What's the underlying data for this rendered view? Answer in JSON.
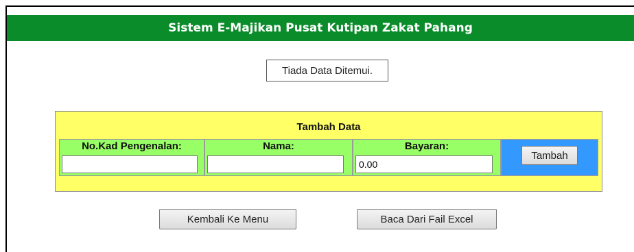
{
  "header": {
    "title": "Sistem E-Majikan Pusat Kutipan Zakat Pahang"
  },
  "notice": {
    "text": "Tiada Data Ditemui."
  },
  "form": {
    "title": "Tambah Data",
    "ic": {
      "label": "No.Kad Pengenalan:",
      "value": ""
    },
    "nama": {
      "label": "Nama:",
      "value": ""
    },
    "bayaran": {
      "label": "Bayaran:",
      "value": "0.00"
    },
    "submit_label": "Tambah"
  },
  "actions": {
    "back_label": "Kembali Ke Menu",
    "excel_label": "Baca Dari Fail Excel"
  },
  "colors": {
    "header_bg": "#0a8c2a",
    "panel_bg": "#ffff66",
    "field_cell_bg": "#99ff66",
    "button_cell_bg": "#3399ff"
  }
}
